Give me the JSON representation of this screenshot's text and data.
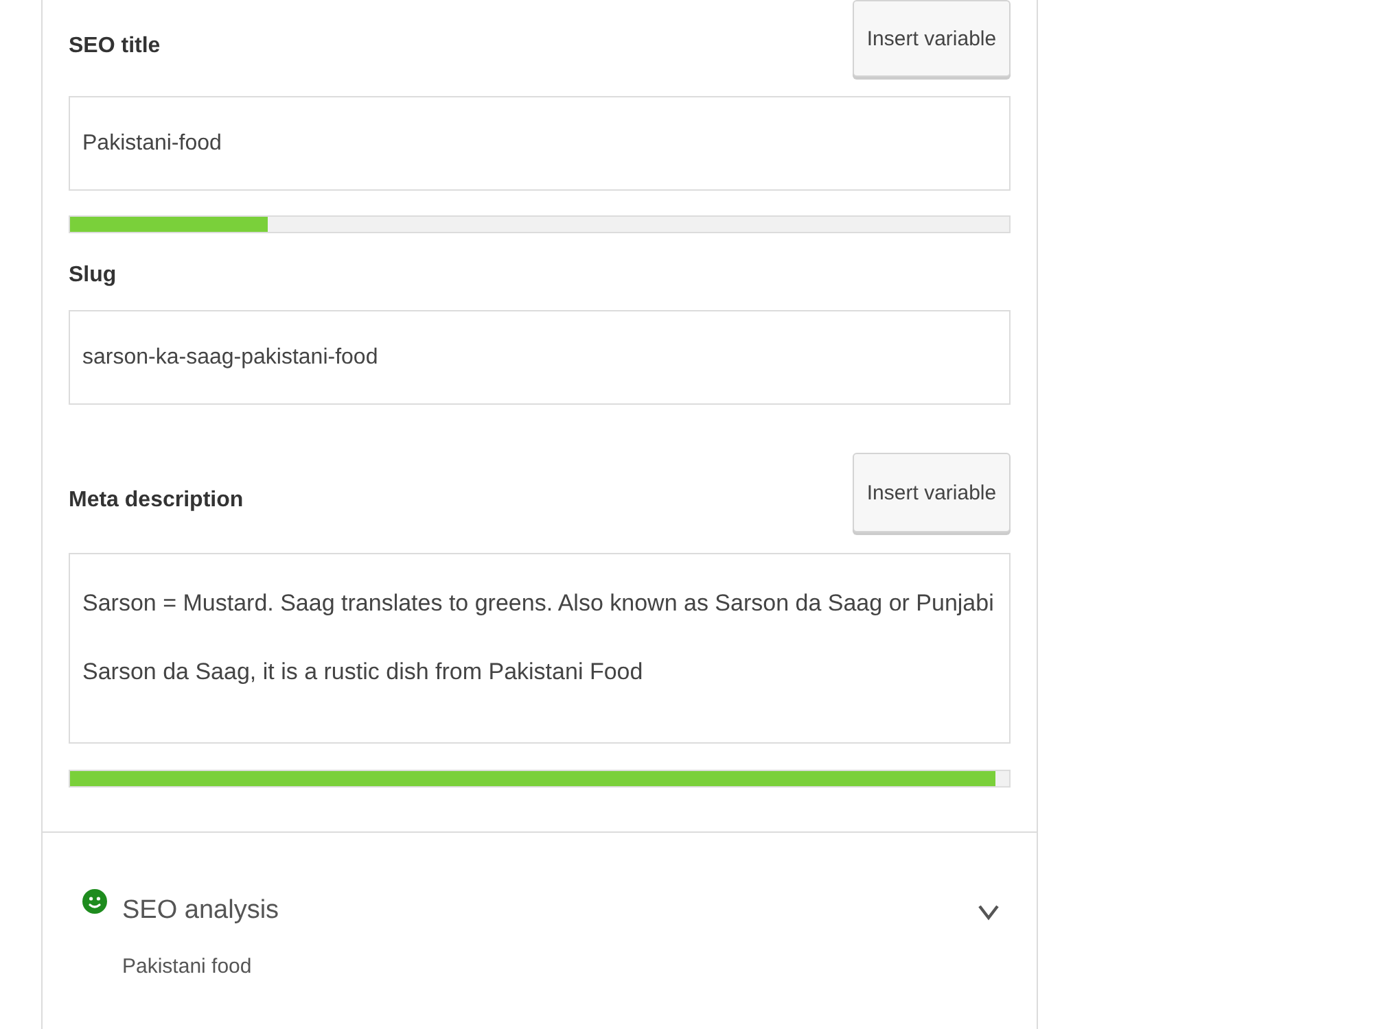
{
  "fields": [
    {
      "kind": "input",
      "label": "SEO title",
      "button": "Insert variable",
      "value": "Pakistani-food",
      "level": 0.21
    },
    {
      "kind": "input",
      "label": "Slug",
      "value": "sarson-ka-saag-pakistani-food"
    },
    {
      "kind": "textarea",
      "label": "Meta description",
      "button": "Insert variable",
      "value": "Sarson = Mustard. Saag translates to greens. Also known as Sarson da Saag or Punjabi Sarson da Saag, it is a rustic dish from Pakistani Food",
      "level": 0.985
    }
  ],
  "analysis": {
    "title": "SEO analysis",
    "keyphrase": "Pakistani food",
    "good": true,
    "expanded": false
  }
}
